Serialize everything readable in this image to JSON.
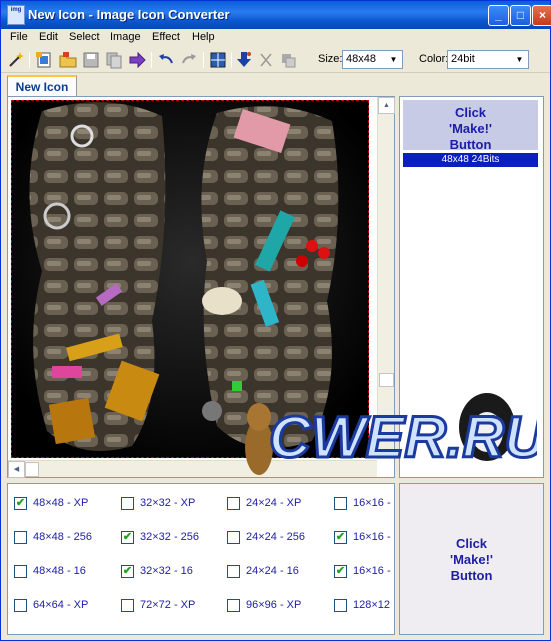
{
  "window": {
    "title": "New Icon - Image Icon Converter",
    "app_icon_text": "img"
  },
  "menu": [
    "File",
    "Edit",
    "Select",
    "Image",
    "Effect",
    "Help"
  ],
  "toolbar": {
    "size_label": "Size:",
    "size_value": "48x48",
    "color_label": "Color:",
    "color_value": "24bit"
  },
  "tabs": [
    {
      "label": "New Icon",
      "active": true
    }
  ],
  "preview": {
    "make_hint": [
      "Click",
      "'Make!'",
      "Button"
    ],
    "selected_format": "48x48 24Bits"
  },
  "sizes": [
    [
      {
        "label": "48×48 - XP",
        "checked": true
      },
      {
        "label": "32×32 - XP",
        "checked": false
      },
      {
        "label": "24×24 - XP",
        "checked": false
      },
      {
        "label": "16×16 -",
        "checked": false
      }
    ],
    [
      {
        "label": "48×48 - 256",
        "checked": false
      },
      {
        "label": "32×32 - 256",
        "checked": true
      },
      {
        "label": "24×24 - 256",
        "checked": false
      },
      {
        "label": "16×16 -",
        "checked": true
      }
    ],
    [
      {
        "label": "48×48 - 16",
        "checked": false
      },
      {
        "label": "32×32 - 16",
        "checked": true
      },
      {
        "label": "24×24 - 16",
        "checked": false
      },
      {
        "label": "16×16 -",
        "checked": true
      }
    ],
    [
      {
        "label": "64×64 - XP",
        "checked": false
      },
      {
        "label": "72×72 - XP",
        "checked": false
      },
      {
        "label": "96×96 - XP",
        "checked": false
      },
      {
        "label": "128×12",
        "checked": false
      }
    ]
  ],
  "make_button": [
    "Click",
    "'Make!'",
    "Button"
  ],
  "watermark": "CWER.RU",
  "colors": {
    "title_bar": "#0a5fd8",
    "make_text": "#1d1da6",
    "selection": "#0a1fbf",
    "check": "#21a121"
  }
}
